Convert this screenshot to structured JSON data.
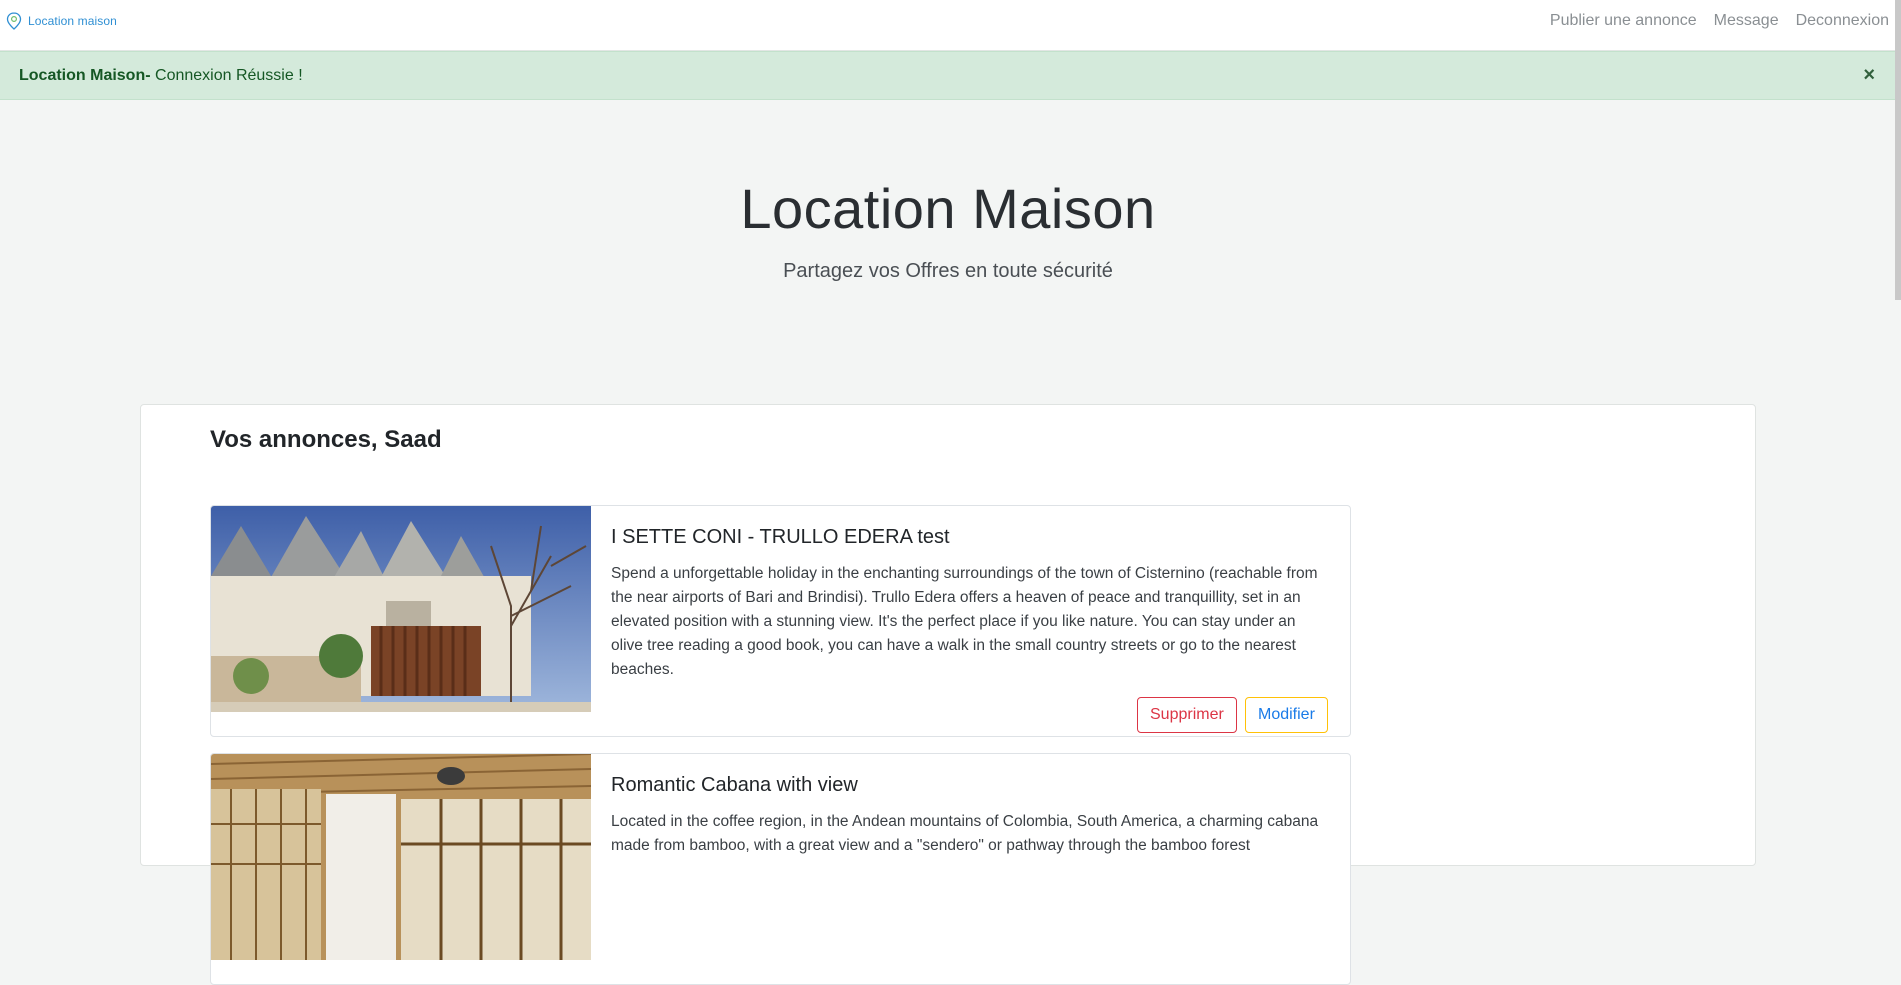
{
  "navbar": {
    "brand": "Location maison",
    "links": [
      "Publier une annonce",
      "Message",
      "Deconnexion"
    ]
  },
  "alert": {
    "strong": "Location Maison-",
    "message": " Connexion Réussie !",
    "close": "×"
  },
  "hero": {
    "title": "Location Maison",
    "subtitle": "Partagez vos Offres en toute sécurité"
  },
  "listings_section": {
    "title": "Vos annonces, Saad",
    "listings": [
      {
        "title": "I SETTE CONI - TRULLO EDERA test",
        "description": "Spend a unforgettable holiday in the enchanting surroundings of the town of Cisternino (reachable from the near airports of Bari and Brindisi). Trullo Edera offers a heaven of peace and tranquillity, set in an elevated position with a stunning view. It's the perfect place if you like nature. You can stay under an olive tree reading a good book, you can have a walk in the small country streets or go to the nearest beaches.",
        "delete_label": "Supprimer",
        "edit_label": "Modifier"
      },
      {
        "title": "Romantic Cabana with view",
        "description": "Located in the coffee region, in the Andean mountains of Colombia, South America, a charming cabana made from bamboo, with a great view and a \"sendero\" or pathway through the bamboo forest"
      }
    ]
  },
  "colors": {
    "alert_bg": "#d4eadb",
    "alert_text": "#155724",
    "brand": "#2f8fd3",
    "danger": "#dc3545",
    "warning_border": "#ffc107",
    "link_blue": "#1a7be8"
  }
}
